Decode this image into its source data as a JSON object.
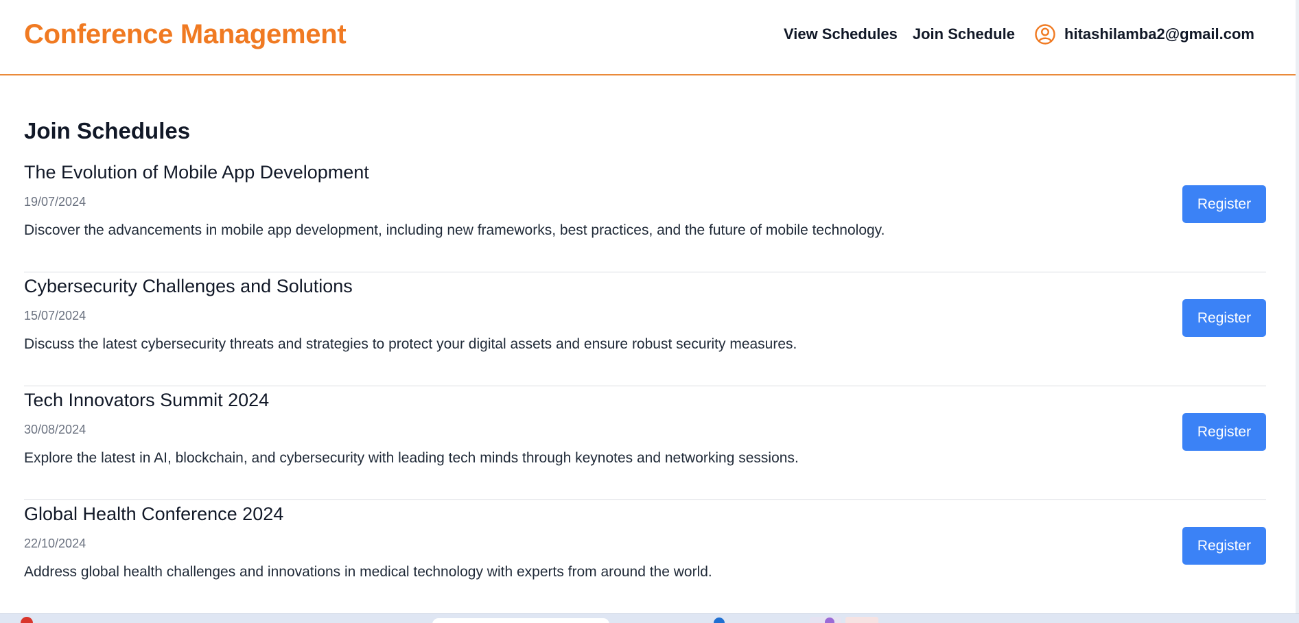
{
  "header": {
    "brand": "Conference Management",
    "nav": [
      {
        "label": "View Schedules"
      },
      {
        "label": "Join Schedule"
      }
    ],
    "user_email": "hitashilamba2@gmail.com",
    "brand_color": "#f07a22",
    "user_icon": "user-circle-icon"
  },
  "main": {
    "title": "Join Schedules",
    "register_label": "Register",
    "button_color": "#3b82f6",
    "items": [
      {
        "title": "The Evolution of Mobile App Development",
        "date": "19/07/2024",
        "description": "Discover the advancements in mobile app development, including new frameworks, best practices, and the future of mobile technology.",
        "button": "Register"
      },
      {
        "title": "Cybersecurity Challenges and Solutions",
        "date": "15/07/2024",
        "description": "Discuss the latest cybersecurity threats and strategies to protect your digital assets and ensure robust security measures.",
        "button": "Register"
      },
      {
        "title": "Tech Innovators Summit 2024",
        "date": "30/08/2024",
        "description": "Explore the latest in AI, blockchain, and cybersecurity with leading tech minds through keynotes and networking sessions.",
        "button": "Register"
      },
      {
        "title": "Global Health Conference 2024",
        "date": "22/10/2024",
        "description": "Address global health challenges and innovations in medical technology with experts from around the world.",
        "button": "Register"
      }
    ]
  }
}
